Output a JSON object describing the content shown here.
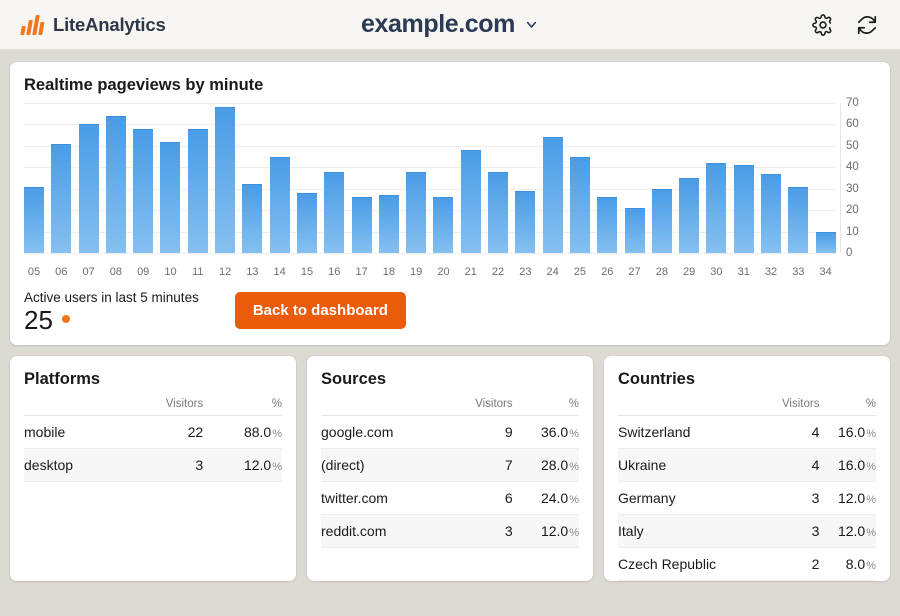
{
  "header": {
    "brand": "LiteAnalytics",
    "logo_icon": "bar-chart-logo-icon",
    "accent_color": "#f3761c",
    "site": "example.com",
    "site_chevron_icon": "chevron-down-icon",
    "settings_icon": "gear-icon",
    "refresh_icon": "refresh-icon"
  },
  "realtime": {
    "title": "Realtime pageviews by minute",
    "active_label": "Active users in last 5 minutes",
    "active_count": "25",
    "active_dot_icon": "status-dot-icon",
    "back_button": "Back to dashboard"
  },
  "chart_data": {
    "type": "bar",
    "title": "Realtime pageviews by minute",
    "xlabel": "",
    "ylabel": "",
    "ylim": [
      0,
      70
    ],
    "yticks": [
      70,
      60,
      50,
      40,
      30,
      20,
      10,
      0
    ],
    "grid": true,
    "legend": null,
    "bar_color_top": "#4a9ce6",
    "bar_color_bottom": "#85c0f0",
    "categories": [
      "05",
      "06",
      "07",
      "08",
      "09",
      "10",
      "11",
      "12",
      "13",
      "14",
      "15",
      "16",
      "17",
      "18",
      "19",
      "20",
      "21",
      "22",
      "23",
      "24",
      "25",
      "26",
      "27",
      "28",
      "29",
      "30",
      "31",
      "32",
      "33",
      "34"
    ],
    "values": [
      31,
      51,
      60,
      64,
      58,
      52,
      58,
      68,
      32,
      45,
      28,
      38,
      26,
      27,
      38,
      26,
      48,
      38,
      29,
      54,
      45,
      26,
      21,
      30,
      35,
      42,
      41,
      37,
      31,
      10
    ]
  },
  "tables": [
    {
      "title": "Platforms",
      "columns": [
        "",
        "Visitors",
        "%"
      ],
      "rows": [
        {
          "name": "mobile",
          "visitors": "22",
          "pct": "88.0",
          "pct_symbol": "%"
        },
        {
          "name": "desktop",
          "visitors": "3",
          "pct": "12.0",
          "pct_symbol": "%"
        }
      ]
    },
    {
      "title": "Sources",
      "columns": [
        "",
        "Visitors",
        "%"
      ],
      "rows": [
        {
          "name": "google.com",
          "visitors": "9",
          "pct": "36.0",
          "pct_symbol": "%"
        },
        {
          "name": "(direct)",
          "visitors": "7",
          "pct": "28.0",
          "pct_symbol": "%"
        },
        {
          "name": "twitter.com",
          "visitors": "6",
          "pct": "24.0",
          "pct_symbol": "%"
        },
        {
          "name": "reddit.com",
          "visitors": "3",
          "pct": "12.0",
          "pct_symbol": "%"
        }
      ]
    },
    {
      "title": "Countries",
      "columns": [
        "",
        "Visitors",
        "%"
      ],
      "rows": [
        {
          "name": "Switzerland",
          "visitors": "4",
          "pct": "16.0",
          "pct_symbol": "%"
        },
        {
          "name": "Ukraine",
          "visitors": "4",
          "pct": "16.0",
          "pct_symbol": "%"
        },
        {
          "name": "Germany",
          "visitors": "3",
          "pct": "12.0",
          "pct_symbol": "%"
        },
        {
          "name": "Italy",
          "visitors": "3",
          "pct": "12.0",
          "pct_symbol": "%"
        },
        {
          "name": "Czech Republic",
          "visitors": "2",
          "pct": "8.0",
          "pct_symbol": "%"
        }
      ]
    }
  ]
}
